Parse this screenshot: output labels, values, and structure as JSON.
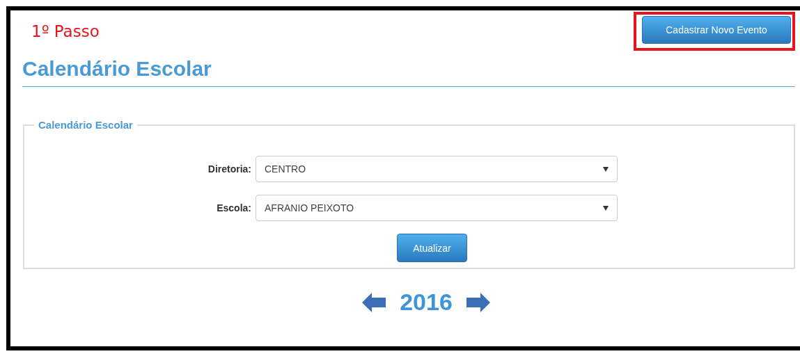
{
  "step_label": "1º Passo",
  "new_event_button": {
    "label": "Cadastrar Novo Evento",
    "highlighted": true
  },
  "page_title": "Calendário Escolar",
  "fieldset": {
    "legend": "Calendário Escolar",
    "fields": [
      {
        "label": "Diretoria:",
        "value": "CENTRO"
      },
      {
        "label": "Escola:",
        "value": "AFRANIO PEIXOTO"
      }
    ],
    "submit_button": "Atualizar"
  },
  "year": "2016"
}
